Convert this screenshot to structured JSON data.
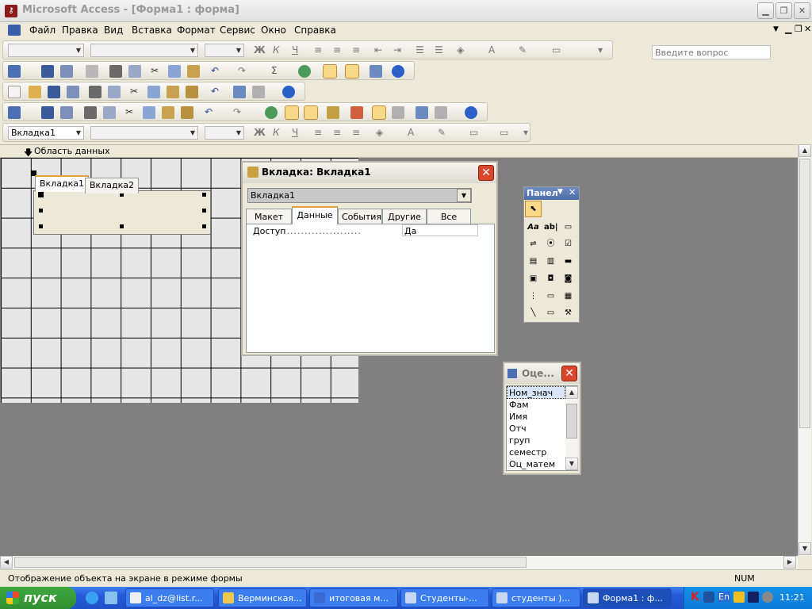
{
  "window": {
    "title": "Microsoft Access - [Форма1 : форма]",
    "app_icon": "key-icon"
  },
  "menu": [
    "Файл",
    "Правка",
    "Вид",
    "Вставка",
    "Формат",
    "Сервис",
    "Окно",
    "Справка"
  ],
  "help_box": {
    "placeholder": "Введите вопрос"
  },
  "format_toolbar_2": {
    "object_combo": "Вкладка1"
  },
  "design": {
    "section_label": "Область данных",
    "tabs": [
      "Вкладка1",
      "Вкладка2"
    ]
  },
  "properties": {
    "title": "Вкладка: Вкладка1",
    "object": "Вкладка1",
    "tabs": [
      "Макет",
      "Данные",
      "События",
      "Другие",
      "Все"
    ],
    "active_tab": "Данные",
    "rows": [
      {
        "name": "Доступ",
        "value": "Да"
      }
    ]
  },
  "toolbox": {
    "title": "Панел"
  },
  "field_list": {
    "title": "Оце...",
    "fields": [
      "Ном_знач",
      "Фам",
      "Имя",
      "Отч",
      "груп",
      "семестр",
      "Оц_матем"
    ]
  },
  "status": {
    "text": "Отображение объекта на экране в режиме формы",
    "mode": "NUM"
  },
  "taskbar": {
    "start": "пуск",
    "tasks": [
      "al_dz@list.r...",
      "Верминская...",
      "итоговая м...",
      "Студенты-...",
      "студенты )...",
      "Форма1 : ф..."
    ],
    "active_index": 5,
    "lang": "En",
    "time": "11:21"
  }
}
